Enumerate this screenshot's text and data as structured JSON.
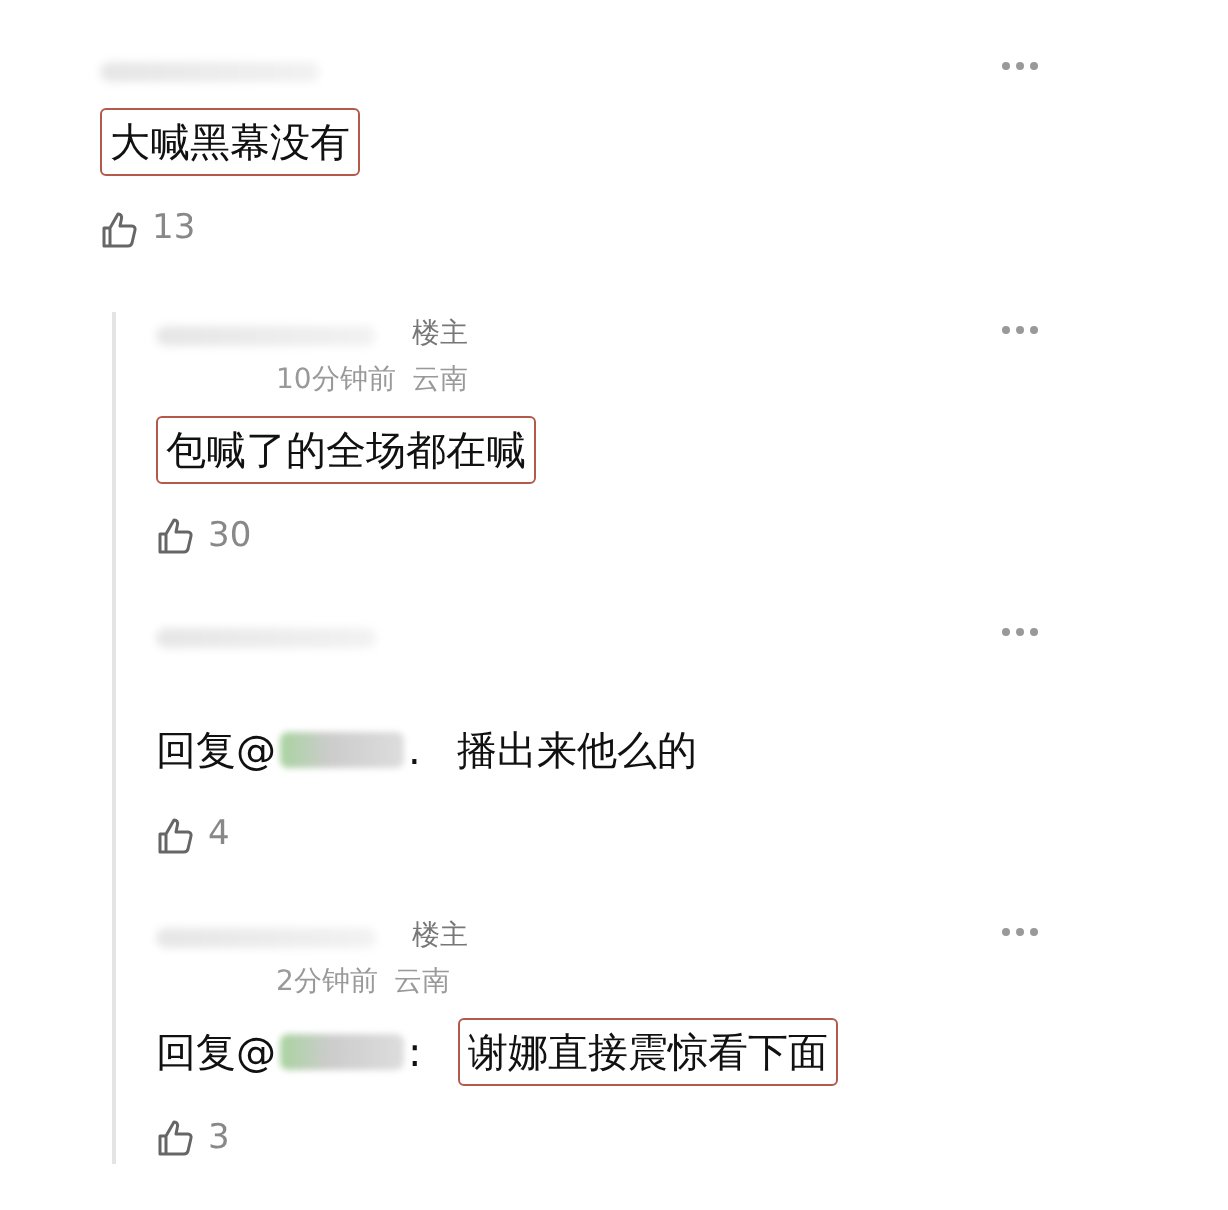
{
  "comment": {
    "text": "大喊黑幕没有",
    "highlighted": true,
    "likes": "13"
  },
  "replies": [
    {
      "author_badge": "楼主",
      "time": "10分钟前",
      "location": "云南",
      "text": "包喊了的全场都在喊",
      "highlighted": true,
      "likes": "30"
    },
    {
      "reply_prefix": "回复@",
      "separator": ".",
      "text": "播出来他么的",
      "highlighted": false,
      "likes": "4"
    },
    {
      "author_badge": "楼主",
      "time": "2分钟前",
      "location": "云南",
      "reply_prefix": "回复@",
      "separator": ":",
      "text": "谢娜直接震惊看下面",
      "highlighted": true,
      "likes": "3"
    }
  ]
}
